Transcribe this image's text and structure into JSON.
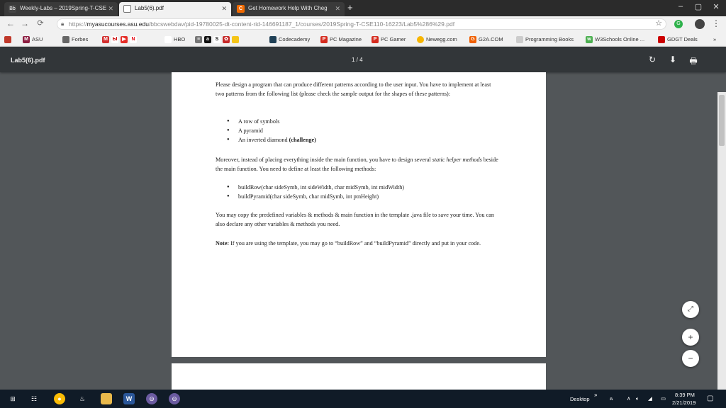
{
  "browser": {
    "tabs": [
      {
        "title": "Weekly-Labs – 2019Spring-T-CSE",
        "active": false
      },
      {
        "title": "Lab5(6).pdf",
        "active": true
      },
      {
        "title": "Get Homework Help With Cheg",
        "active": false
      }
    ],
    "url_scheme": "https://",
    "url_host": "myasucourses.asu.edu",
    "url_path": "/bbcswebdav/pid-19780025-dt-content-rid-146691187_1/courses/2019Spring-T-CSE110-16223/Lab5%286%29.pdf"
  },
  "bookmarks": [
    {
      "label": "ASU",
      "color": "#8c1d40"
    },
    {
      "label": "Forbes",
      "color": "#333333"
    },
    {
      "label": "HBO",
      "color": "#111111"
    },
    {
      "label": "Codecademy",
      "color": "#1f4056"
    },
    {
      "label": "PC Magazine",
      "color": "#d52b1e"
    },
    {
      "label": "PC Gamer",
      "color": "#d52b1e"
    },
    {
      "label": "Newegg.com",
      "color": "#f7b500"
    },
    {
      "label": "G2A.COM",
      "color": "#f05f00"
    },
    {
      "label": "Programming Books",
      "color": "#888888"
    },
    {
      "label": "W3Schools Online ...",
      "color": "#4caf50"
    },
    {
      "label": "GDGT Deals",
      "color": "#cc0000"
    }
  ],
  "pdf": {
    "title": "Lab5(6).pdf",
    "page_indicator": "1 / 4",
    "para1": "Please design a program that can produce different patterns according to the user input. You have to implement at least two patterns from the following list (please check the sample output for the shapes of these patterns):",
    "patterns": [
      "A row of symbols",
      "A pyramid",
      "An inverted diamond"
    ],
    "challenge_label": "(challenge)",
    "para2_start": "Moreover, instead of placing everything inside the main function, you have to design several",
    "para2_italic": "static helper methods",
    "para2_end": "beside the main function. You need to define at least the following methods:",
    "methods": [
      "buildRow(char sideSymb, int sideWidth, char midSymb, int midWidth)",
      "buildPyramid(char sideSymb, char midSymb, int ptnHeight)"
    ],
    "para3": "You may copy the predefined variables & methods & main function in the template .java file to save your time. You can also declare any other variables & methods you need.",
    "note_label": "Note:",
    "note_text": "If you are using the template, you may go to “buildRow” and “buildPyramid” directly and put in your code."
  },
  "taskbar": {
    "desktop_label": "Desktop",
    "time": "8:39 PM",
    "date": "2/21/2019"
  }
}
